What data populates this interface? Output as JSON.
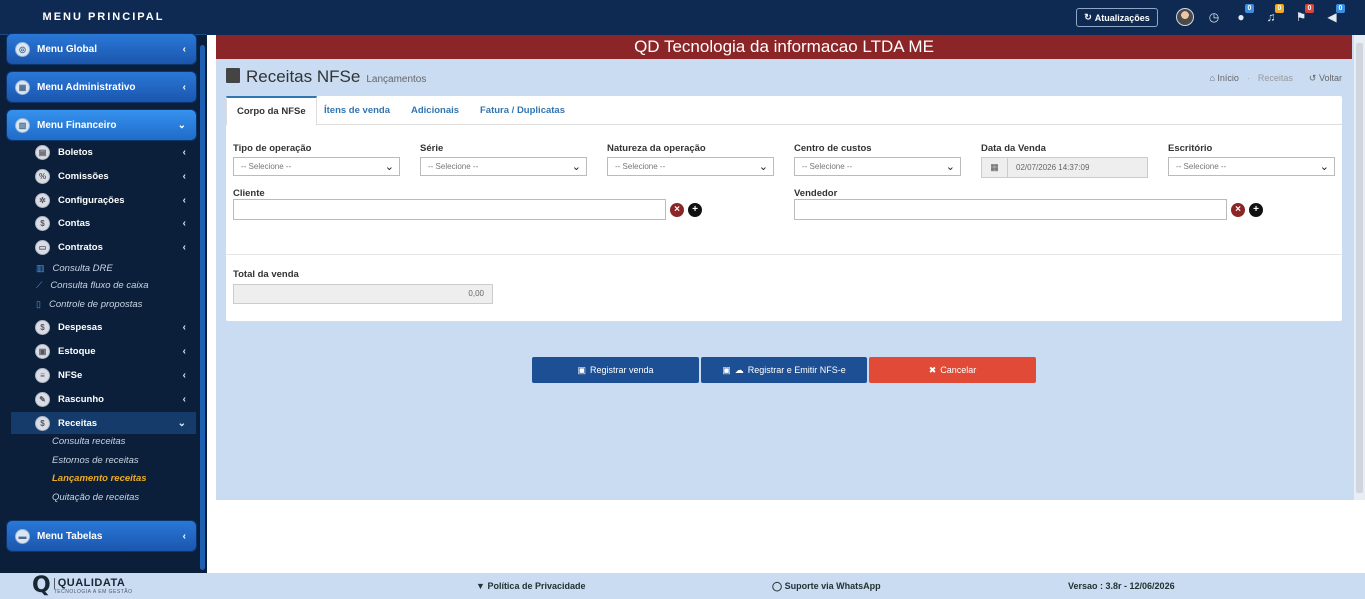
{
  "sidebar": {
    "title": "MENU PRINCIPAL",
    "menus": {
      "global": "Menu Global",
      "admin": "Menu Administrativo",
      "financeiro": "Menu Financeiro",
      "tabelas": "Menu Tabelas"
    },
    "financeiro_items": {
      "boletos": "Boletos",
      "comissoes": "Comissões",
      "configuracoes": "Configurações",
      "contas": "Contas",
      "contratos": "Contratos",
      "consulta_dre": "Consulta DRE",
      "consulta_fluxo": "Consulta fluxo de caixa",
      "controle_propostas": "Controle de propostas",
      "despesas": "Despesas",
      "estoque": "Estoque",
      "nfse": "NFSe",
      "rascunho": "Rascunho",
      "receitas": "Receitas"
    },
    "receitas_items": {
      "consulta": "Consulta receitas",
      "estornos": "Estornos de receitas",
      "lancamento": "Lançamento receitas",
      "quitacao": "Quitação de receitas"
    }
  },
  "topbar": {
    "atualizacoes": "Atualizações",
    "badges": {
      "chat": "0",
      "bell": "0",
      "flag": "0",
      "megaphone": "0"
    },
    "badge_colors": {
      "chat": "#3b8fe0",
      "bell": "#f0ad1f",
      "flag": "#d9463a",
      "megaphone": "#3b8fe0"
    }
  },
  "banner": "QD Tecnologia da informacao LTDA ME",
  "page": {
    "title": "Receitas NFSe",
    "subtitle": "Lançamentos",
    "breadcrumb": {
      "home": "Início",
      "current": "Receitas",
      "back": "Voltar"
    }
  },
  "tabs": [
    "Corpo da NFSe",
    "Ítens de venda",
    "Adicionais",
    "Fatura / Duplicatas"
  ],
  "form": {
    "tipo_operacao": {
      "label": "Tipo de operação",
      "value": "-- Selecione --"
    },
    "serie": {
      "label": "Série",
      "value": "-- Selecione --"
    },
    "natureza": {
      "label": "Natureza da operação",
      "value": "-- Selecione --"
    },
    "centro_custos": {
      "label": "Centro de custos",
      "value": "-- Selecione --"
    },
    "data_venda": {
      "label": "Data da Venda",
      "value": "02/07/2026 14:37:09"
    },
    "escritorio": {
      "label": "Escritório",
      "value": "-- Selecione --"
    },
    "cliente": {
      "label": "Cliente",
      "value": ""
    },
    "vendedor": {
      "label": "Vendedor",
      "value": ""
    },
    "total": {
      "label": "Total da venda",
      "value": "0,00"
    }
  },
  "actions": {
    "registrar": "Registrar venda",
    "registrar_emitir": "Registrar e Emitir NFS-e",
    "cancelar": "Cancelar"
  },
  "footer": {
    "brand": "QUALIDATA",
    "tagline": "TECNOLOGIA A EM GESTÃO",
    "privacy": "Política de Privacidade",
    "whatsapp": "Suporte via WhatsApp",
    "version": "Versao : 3.8r - 12/06/2026"
  },
  "colors": {
    "banner": "#8b2527",
    "primary_button": "#1d4f95",
    "cancel_button": "#e04a37",
    "current_submenu": "#f0ad1f"
  }
}
